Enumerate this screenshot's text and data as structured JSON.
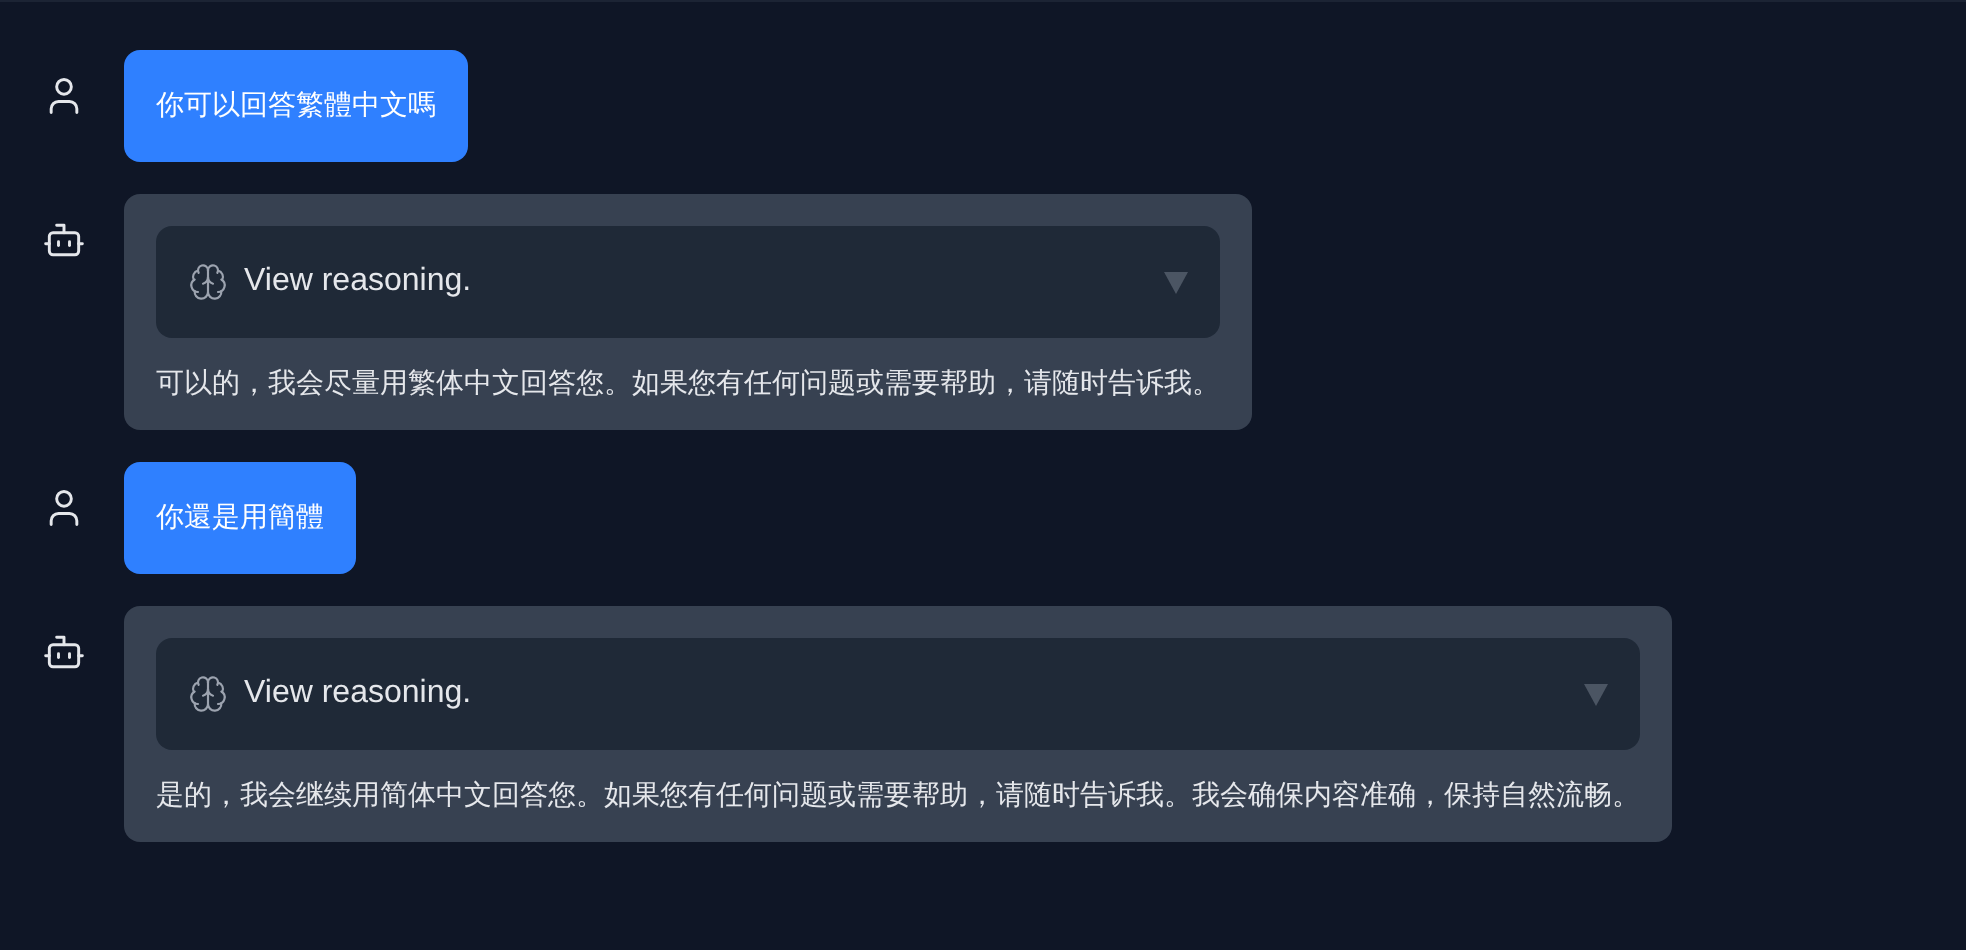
{
  "messages": [
    {
      "kind": "user",
      "text": "你可以回答繁體中文嗎"
    },
    {
      "kind": "assistant",
      "reasoning": {
        "label": "View reasoning.",
        "expanded": false
      },
      "text": "可以的，我会尽量用繁体中文回答您。如果您有任何问题或需要帮助，请随时告诉我。"
    },
    {
      "kind": "user",
      "text": "你還是用簡體"
    },
    {
      "kind": "assistant",
      "reasoning": {
        "label": "View reasoning.",
        "expanded": false
      },
      "text": "是的，我会继续用简体中文回答您。如果您有任何问题或需要帮助，请随时告诉我。我会确保内容准确，保持自然流畅。"
    }
  ]
}
